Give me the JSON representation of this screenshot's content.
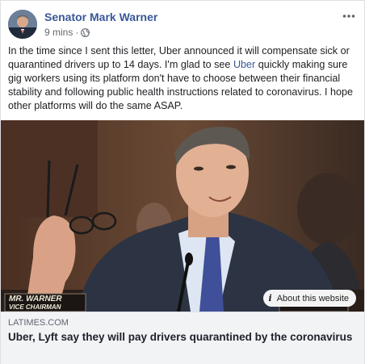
{
  "post": {
    "author": "Senator Mark Warner",
    "time": "9 mins",
    "separator": "·",
    "more_icon": "more-dots-icon",
    "privacy_icon": "globe-icon",
    "text_before_link": "In the time since I sent this letter, Uber announced it will compensate sick or quarantined drivers up to 14 days. I'm glad to see ",
    "text_link": "Uber",
    "text_after_link": " quickly making sure gig workers using its platform don't have to choose between their financial stability and following public health instructions related to coronavirus. I hope other platforms will do the same ASAP."
  },
  "image": {
    "nameplate_line1": "MR. WARNER",
    "nameplate_line2": "VICE CHAIRMAN",
    "about_label": "About this website",
    "about_icon": "info-icon"
  },
  "link": {
    "domain": "LATIMES.COM",
    "headline": "Uber, Lyft say they will pay drivers quarantined by the coronavirus"
  },
  "colors": {
    "author_blue": "#385898",
    "link_bg": "#f2f3f5",
    "meta_gray": "#606770"
  }
}
